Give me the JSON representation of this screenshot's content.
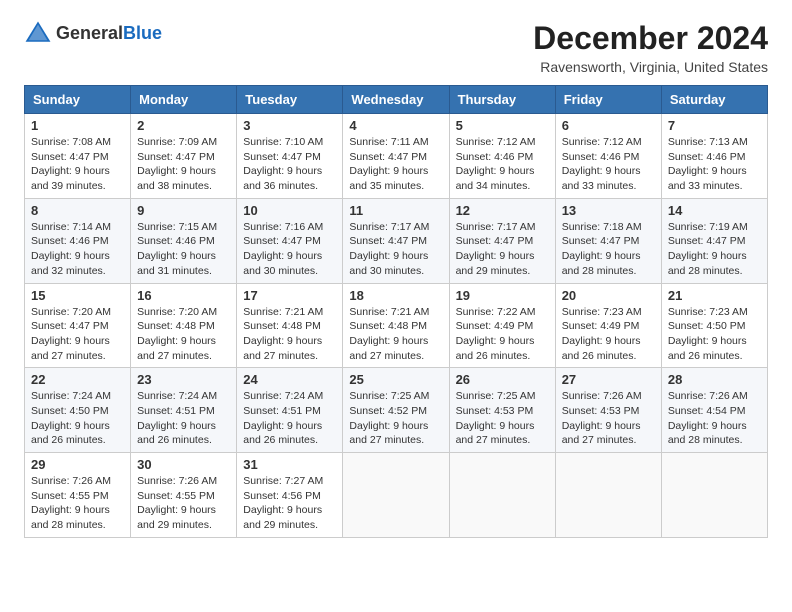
{
  "logo": {
    "general": "General",
    "blue": "Blue"
  },
  "header": {
    "title": "December 2024",
    "subtitle": "Ravensworth, Virginia, United States"
  },
  "weekdays": [
    "Sunday",
    "Monday",
    "Tuesday",
    "Wednesday",
    "Thursday",
    "Friday",
    "Saturday"
  ],
  "weeks": [
    [
      {
        "day": "1",
        "info": "Sunrise: 7:08 AM\nSunset: 4:47 PM\nDaylight: 9 hours\nand 39 minutes."
      },
      {
        "day": "2",
        "info": "Sunrise: 7:09 AM\nSunset: 4:47 PM\nDaylight: 9 hours\nand 38 minutes."
      },
      {
        "day": "3",
        "info": "Sunrise: 7:10 AM\nSunset: 4:47 PM\nDaylight: 9 hours\nand 36 minutes."
      },
      {
        "day": "4",
        "info": "Sunrise: 7:11 AM\nSunset: 4:47 PM\nDaylight: 9 hours\nand 35 minutes."
      },
      {
        "day": "5",
        "info": "Sunrise: 7:12 AM\nSunset: 4:46 PM\nDaylight: 9 hours\nand 34 minutes."
      },
      {
        "day": "6",
        "info": "Sunrise: 7:12 AM\nSunset: 4:46 PM\nDaylight: 9 hours\nand 33 minutes."
      },
      {
        "day": "7",
        "info": "Sunrise: 7:13 AM\nSunset: 4:46 PM\nDaylight: 9 hours\nand 33 minutes."
      }
    ],
    [
      {
        "day": "8",
        "info": "Sunrise: 7:14 AM\nSunset: 4:46 PM\nDaylight: 9 hours\nand 32 minutes."
      },
      {
        "day": "9",
        "info": "Sunrise: 7:15 AM\nSunset: 4:46 PM\nDaylight: 9 hours\nand 31 minutes."
      },
      {
        "day": "10",
        "info": "Sunrise: 7:16 AM\nSunset: 4:47 PM\nDaylight: 9 hours\nand 30 minutes."
      },
      {
        "day": "11",
        "info": "Sunrise: 7:17 AM\nSunset: 4:47 PM\nDaylight: 9 hours\nand 30 minutes."
      },
      {
        "day": "12",
        "info": "Sunrise: 7:17 AM\nSunset: 4:47 PM\nDaylight: 9 hours\nand 29 minutes."
      },
      {
        "day": "13",
        "info": "Sunrise: 7:18 AM\nSunset: 4:47 PM\nDaylight: 9 hours\nand 28 minutes."
      },
      {
        "day": "14",
        "info": "Sunrise: 7:19 AM\nSunset: 4:47 PM\nDaylight: 9 hours\nand 28 minutes."
      }
    ],
    [
      {
        "day": "15",
        "info": "Sunrise: 7:20 AM\nSunset: 4:47 PM\nDaylight: 9 hours\nand 27 minutes."
      },
      {
        "day": "16",
        "info": "Sunrise: 7:20 AM\nSunset: 4:48 PM\nDaylight: 9 hours\nand 27 minutes."
      },
      {
        "day": "17",
        "info": "Sunrise: 7:21 AM\nSunset: 4:48 PM\nDaylight: 9 hours\nand 27 minutes."
      },
      {
        "day": "18",
        "info": "Sunrise: 7:21 AM\nSunset: 4:48 PM\nDaylight: 9 hours\nand 27 minutes."
      },
      {
        "day": "19",
        "info": "Sunrise: 7:22 AM\nSunset: 4:49 PM\nDaylight: 9 hours\nand 26 minutes."
      },
      {
        "day": "20",
        "info": "Sunrise: 7:23 AM\nSunset: 4:49 PM\nDaylight: 9 hours\nand 26 minutes."
      },
      {
        "day": "21",
        "info": "Sunrise: 7:23 AM\nSunset: 4:50 PM\nDaylight: 9 hours\nand 26 minutes."
      }
    ],
    [
      {
        "day": "22",
        "info": "Sunrise: 7:24 AM\nSunset: 4:50 PM\nDaylight: 9 hours\nand 26 minutes."
      },
      {
        "day": "23",
        "info": "Sunrise: 7:24 AM\nSunset: 4:51 PM\nDaylight: 9 hours\nand 26 minutes."
      },
      {
        "day": "24",
        "info": "Sunrise: 7:24 AM\nSunset: 4:51 PM\nDaylight: 9 hours\nand 26 minutes."
      },
      {
        "day": "25",
        "info": "Sunrise: 7:25 AM\nSunset: 4:52 PM\nDaylight: 9 hours\nand 27 minutes."
      },
      {
        "day": "26",
        "info": "Sunrise: 7:25 AM\nSunset: 4:53 PM\nDaylight: 9 hours\nand 27 minutes."
      },
      {
        "day": "27",
        "info": "Sunrise: 7:26 AM\nSunset: 4:53 PM\nDaylight: 9 hours\nand 27 minutes."
      },
      {
        "day": "28",
        "info": "Sunrise: 7:26 AM\nSunset: 4:54 PM\nDaylight: 9 hours\nand 28 minutes."
      }
    ],
    [
      {
        "day": "29",
        "info": "Sunrise: 7:26 AM\nSunset: 4:55 PM\nDaylight: 9 hours\nand 28 minutes."
      },
      {
        "day": "30",
        "info": "Sunrise: 7:26 AM\nSunset: 4:55 PM\nDaylight: 9 hours\nand 29 minutes."
      },
      {
        "day": "31",
        "info": "Sunrise: 7:27 AM\nSunset: 4:56 PM\nDaylight: 9 hours\nand 29 minutes."
      },
      {
        "day": "",
        "info": ""
      },
      {
        "day": "",
        "info": ""
      },
      {
        "day": "",
        "info": ""
      },
      {
        "day": "",
        "info": ""
      }
    ]
  ]
}
